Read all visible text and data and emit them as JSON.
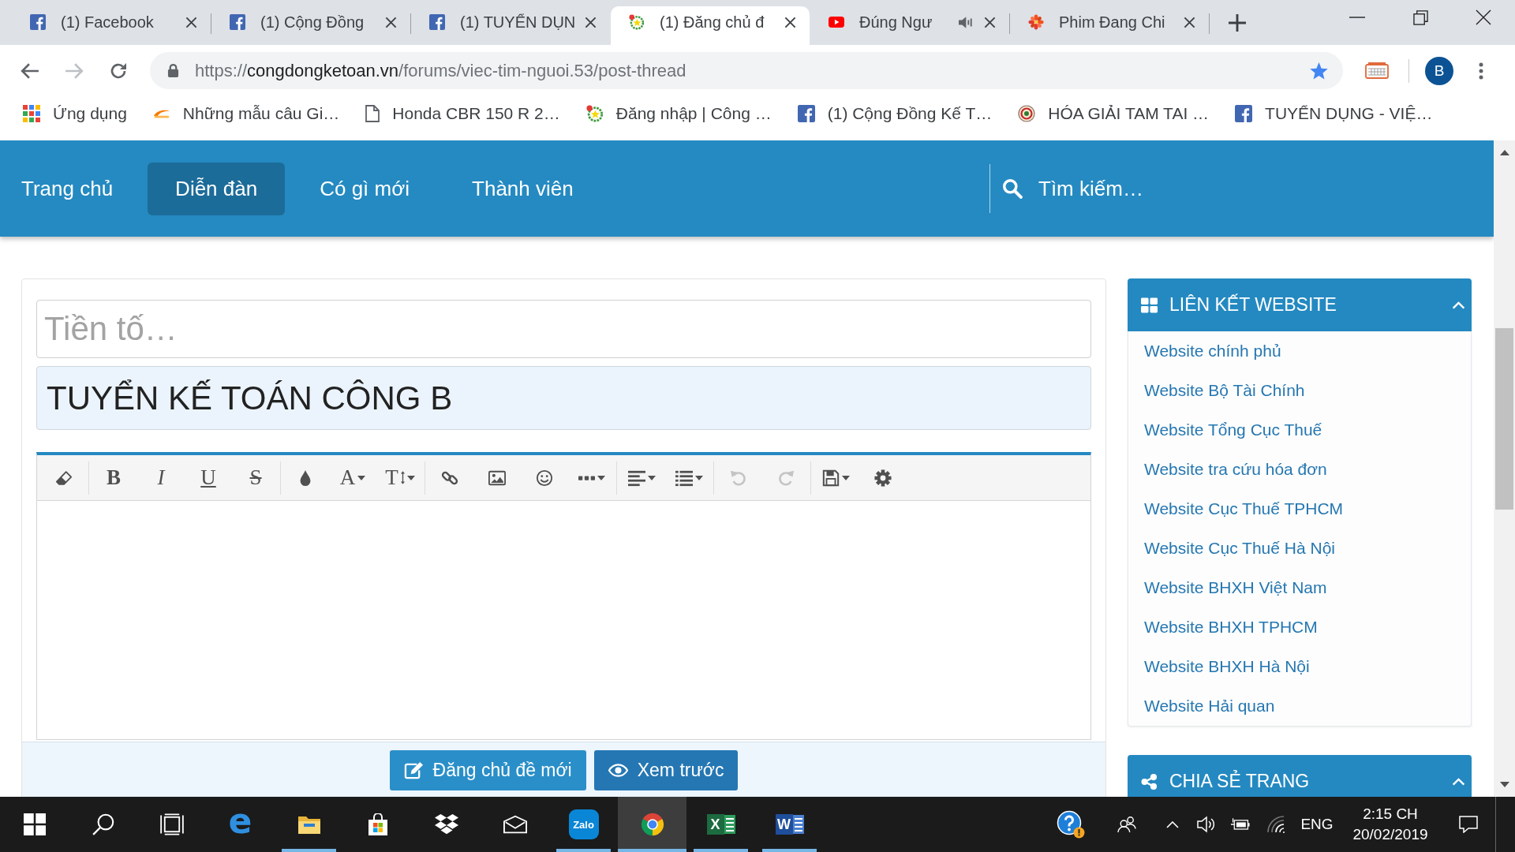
{
  "browser": {
    "tabs": [
      {
        "title": "(1) Facebook",
        "selected": false,
        "audio": false
      },
      {
        "title": "(1) Cộng Đồng",
        "selected": false,
        "audio": false
      },
      {
        "title": "(1) TUYỂN DỤN",
        "selected": false,
        "audio": false
      },
      {
        "title": "(1) Đăng chủ đ",
        "selected": true,
        "audio": false
      },
      {
        "title": "Đúng Ngư",
        "selected": false,
        "audio": true
      },
      {
        "title": "Phim Đang Chi",
        "selected": false,
        "audio": false
      }
    ],
    "nav_buttons": [
      {
        "disabled": false
      },
      {
        "disabled": true
      },
      {
        "disabled": false
      }
    ],
    "address": {
      "scheme": "https://",
      "host": "congdongketoan.vn",
      "path": "/forums/viec-tim-nguoi.53/post-thread",
      "bookmarked": true
    },
    "profile": {
      "initial": "B"
    },
    "bookmarks": [
      {
        "label": "Ứng dụng"
      },
      {
        "label": "Những mẫu câu Gi…"
      },
      {
        "label": "Honda CBR 150 R 2…"
      },
      {
        "label": "Đăng nhập | Công …"
      },
      {
        "label": "(1) Cộng Đồng Kế T…"
      },
      {
        "label": "HÓA GIẢI TAM TAI …"
      },
      {
        "label": "TUYỂN DỤNG - VIỆ…"
      }
    ]
  },
  "site_nav": {
    "items": [
      {
        "label": "Trang chủ",
        "selected": false
      },
      {
        "label": "Diễn đàn",
        "selected": true
      },
      {
        "label": "Có gì mới",
        "selected": false
      },
      {
        "label": "Thành viên",
        "selected": false
      }
    ],
    "search_label": "Tìm kiếm…"
  },
  "form": {
    "prefix_field": {
      "placeholder": "Tiền tố…"
    },
    "title_field": {
      "value": "TUYỂN KẾ TOÁN CÔNG B"
    },
    "toolbar": {
      "groups": [
        [
          {
            "kind": "icon",
            "disabled": false,
            "dropdown": false
          }
        ],
        [
          {
            "kind": "glyph",
            "label": "B",
            "disabled": false,
            "dropdown": false
          },
          {
            "kind": "glyph",
            "label": "I",
            "disabled": false,
            "dropdown": false
          },
          {
            "kind": "glyph",
            "label": "U",
            "disabled": false,
            "dropdown": false
          },
          {
            "kind": "glyph",
            "label": "S",
            "disabled": false,
            "dropdown": false
          }
        ],
        [
          {
            "kind": "icon",
            "disabled": false,
            "dropdown": false
          },
          {
            "kind": "glyph",
            "label": "A",
            "disabled": false,
            "dropdown": true
          },
          {
            "kind": "glyph",
            "label": "T",
            "disabled": false,
            "dropdown": true
          }
        ],
        [
          {
            "kind": "icon",
            "disabled": false,
            "dropdown": false
          },
          {
            "kind": "icon",
            "disabled": false,
            "dropdown": false
          },
          {
            "kind": "icon",
            "disabled": false,
            "dropdown": false
          },
          {
            "kind": "icon",
            "disabled": false,
            "dropdown": true
          }
        ],
        [
          {
            "kind": "icon",
            "disabled": false,
            "dropdown": true
          },
          {
            "kind": "icon",
            "disabled": false,
            "dropdown": true
          }
        ],
        [
          {
            "kind": "icon",
            "disabled": true,
            "dropdown": false
          },
          {
            "kind": "icon",
            "disabled": true,
            "dropdown": false
          }
        ],
        [
          {
            "kind": "icon",
            "disabled": false,
            "dropdown": true
          },
          {
            "kind": "icon",
            "disabled": false,
            "dropdown": false
          }
        ]
      ]
    },
    "buttons": [
      {
        "label": "Đăng chủ đề mới",
        "primary": true
      },
      {
        "label": "Xem trước",
        "primary": false
      }
    ]
  },
  "sidebar": {
    "widgets": [
      {
        "title": "LIÊN KẾT WEBSITE",
        "expanded": true,
        "links": [
          "Website chính phủ",
          "Website Bộ Tài Chính",
          "Website Tổng Cục Thuế",
          "Website tra cứu hóa đơn",
          "Website Cục Thuế TPHCM",
          "Website Cục Thuế Hà Nội",
          "Website BHXH Việt Nam",
          "Website BHXH TPHCM",
          "Website BHXH Hà Nội",
          "Website Hải quan"
        ]
      },
      {
        "title": "CHIA SẺ TRANG",
        "expanded": true
      }
    ]
  },
  "taskbar": {
    "apps": [
      {
        "logo_text": "e",
        "running": false,
        "selected": false
      },
      {
        "running": true,
        "selected": false
      },
      {
        "running": false,
        "selected": false
      },
      {
        "running": false,
        "selected": false
      },
      {
        "running": false,
        "selected": false
      },
      {
        "logo_text": "Zalo",
        "running": true,
        "selected": false
      },
      {
        "running": true,
        "selected": true
      },
      {
        "logo_text": "X",
        "running": true,
        "selected": false
      },
      {
        "logo_text": "W",
        "running": true,
        "selected": false
      }
    ],
    "tray": {
      "language": "ENG",
      "time": "2:15 CH",
      "date": "20/02/2019"
    }
  }
}
